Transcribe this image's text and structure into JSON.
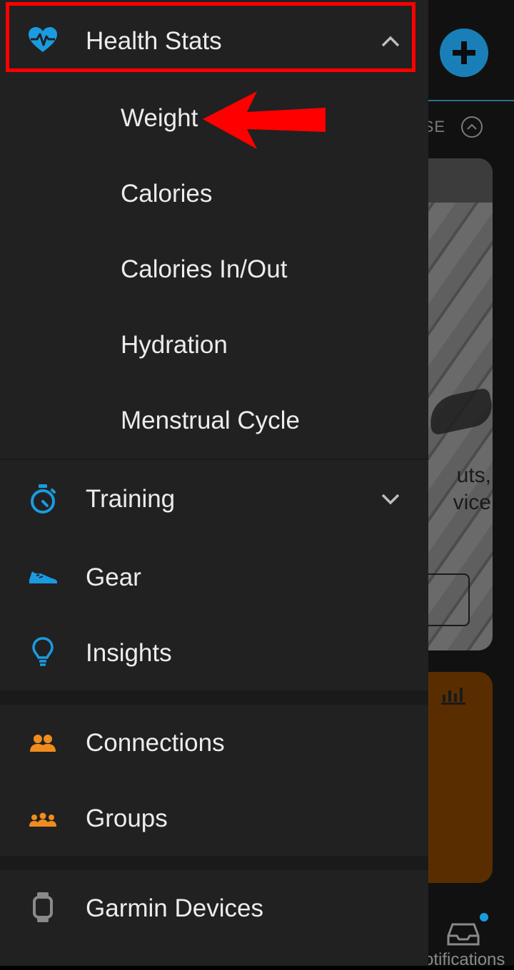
{
  "background": {
    "collapse_text": "SE",
    "card_text_1": "uts,",
    "card_text_2": "vice",
    "notifications_label": "otifications"
  },
  "drawer": {
    "health_stats": {
      "label": "Health Stats",
      "icon": "heart-pulse-icon",
      "expanded": true
    },
    "health_sub_items": [
      {
        "label": "Weight"
      },
      {
        "label": "Calories"
      },
      {
        "label": "Calories In/Out"
      },
      {
        "label": "Hydration"
      },
      {
        "label": "Menstrual Cycle"
      }
    ],
    "training": {
      "label": "Training",
      "icon": "stopwatch-icon",
      "expanded": false
    },
    "gear": {
      "label": "Gear",
      "icon": "shoe-icon"
    },
    "insights": {
      "label": "Insights",
      "icon": "lightbulb-icon"
    },
    "connections": {
      "label": "Connections",
      "icon": "people-icon"
    },
    "groups": {
      "label": "Groups",
      "icon": "group-icon"
    },
    "garmin_devices": {
      "label": "Garmin Devices",
      "icon": "watch-icon"
    }
  },
  "colors": {
    "drawer_bg": "#212121",
    "accent_blue": "#1a9be0",
    "accent_orange": "#f08c1e",
    "annotation_red": "#ff0000"
  }
}
